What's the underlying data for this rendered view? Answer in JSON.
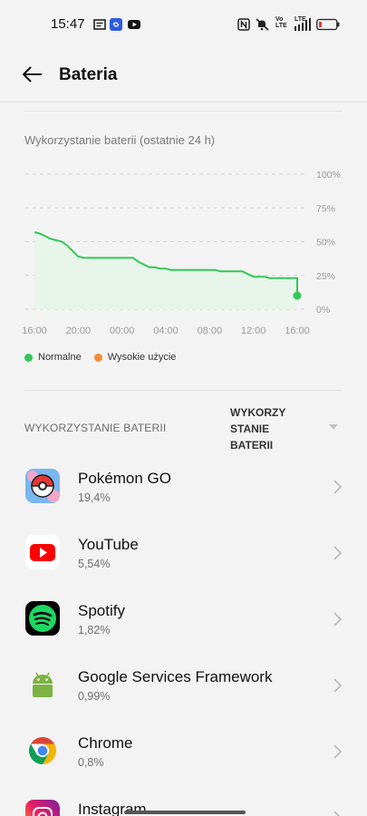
{
  "status_bar": {
    "time": "15:47",
    "left_icons": [
      "notification-icon",
      "link-app-icon",
      "youtube-notification-icon"
    ],
    "right_icons": [
      "nfc-icon",
      "mute-icon",
      "volte-icon",
      "signal-icon",
      "battery-low-icon"
    ],
    "volte_text": "Vo LTE",
    "lte_text": "LTE"
  },
  "app_bar": {
    "title": "Bateria",
    "back_icon": "arrow-left-icon"
  },
  "chart": {
    "section_title": "Wykorzystanie baterii (ostatnie 24 h)",
    "legend": [
      {
        "label": "Normalne",
        "color": "#34c759"
      },
      {
        "label": "Wysokie użycie",
        "color": "#f28c38"
      }
    ]
  },
  "chart_data": {
    "type": "area",
    "x": [
      0,
      0.5,
      1,
      1.5,
      2,
      2.5,
      3,
      3.5,
      4,
      4.5,
      5,
      5.5,
      6,
      6.5,
      7,
      7.5,
      8,
      8.5,
      9,
      9.5,
      10,
      10.5,
      11,
      11.5,
      12,
      12.5,
      13,
      13.5,
      14,
      14.5,
      15,
      15.5,
      16,
      16.5,
      17,
      17.5,
      18,
      18.5,
      19,
      19.5,
      20,
      20.5,
      21,
      21.5,
      22,
      22.5,
      23,
      23.5,
      24
    ],
    "y": [
      57,
      56,
      54,
      52,
      51,
      50,
      47,
      43,
      39,
      38,
      38,
      38,
      38,
      38,
      38,
      38,
      38,
      38,
      38,
      35,
      33,
      31,
      31,
      30,
      30,
      29,
      29,
      29,
      29,
      29,
      29,
      29,
      29,
      29,
      28,
      28,
      28,
      28,
      28,
      26,
      24,
      24,
      24,
      23,
      23,
      23,
      23,
      23,
      23
    ],
    "x_tick_labels": [
      "16:00",
      "20:00",
      "00:00",
      "04:00",
      "08:00",
      "12:00",
      "16:00"
    ],
    "y_tick_labels": [
      "100%",
      "75%",
      "50%",
      "25%",
      "0%"
    ],
    "ylim": [
      0,
      100
    ],
    "series_color": "#34c759",
    "fill_color": "#e7f5ea",
    "end_point": {
      "x": 24,
      "y": 10
    },
    "grid": true
  },
  "usage": {
    "section_header": "WYKORZYSTANIE BATERII",
    "sort_label": "WYKORZY STANIE BATERII",
    "apps": [
      {
        "name": "Pokémon GO",
        "pct": "19,4%",
        "icon": "pokemon-go-icon"
      },
      {
        "name": "YouTube",
        "pct": "5,54%",
        "icon": "youtube-icon"
      },
      {
        "name": "Spotify",
        "pct": "1,82%",
        "icon": "spotify-icon"
      },
      {
        "name": "Google Services Framework",
        "pct": "0,99%",
        "icon": "android-icon"
      },
      {
        "name": "Chrome",
        "pct": "0,8%",
        "icon": "chrome-icon"
      },
      {
        "name": "Instagram",
        "pct": "",
        "icon": "instagram-icon"
      }
    ]
  }
}
